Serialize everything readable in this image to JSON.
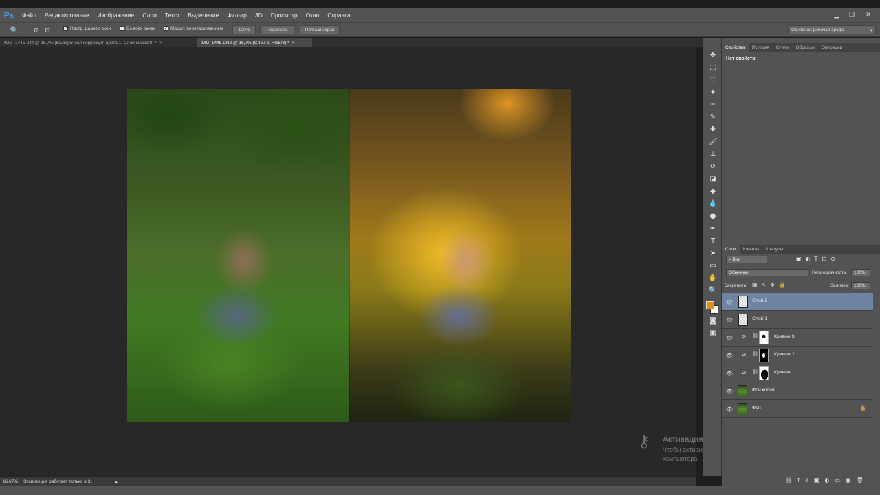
{
  "app": {
    "logo": "Ps"
  },
  "menu": [
    "Файл",
    "Редактирование",
    "Изображение",
    "Слои",
    "Текст",
    "Выделение",
    "Фильтр",
    "3D",
    "Просмотр",
    "Окно",
    "Справка"
  ],
  "options": {
    "resize_windows": "Настр. размер окон",
    "all_windows": "Во всех окнах",
    "scrubby_zoom": "Масшт. перетаскиванием",
    "zoom_100": "100%",
    "fit_button": "Подогнать",
    "fill_screen": "Полный экран",
    "workspace": "Основная рабочая среда"
  },
  "tabs": [
    {
      "label": "IMG_1445-2.tif @ 16,7% (Выборочная коррекция цвета 1, Слой-маска/8) *"
    },
    {
      "label": "IMG_1445.CR2 @ 16,7% (Слой 2, RGB/8) *"
    }
  ],
  "status": {
    "zoom": "16,67%",
    "message": "Экспозиция работает только в 3..."
  },
  "properties_panel": {
    "tabs": [
      "Свойства",
      "История",
      "Стили",
      "Образцы",
      "Операции"
    ],
    "title": "Нет свойств"
  },
  "layers_panel": {
    "tabs": [
      "Слои",
      "Каналы",
      "Контуры"
    ],
    "filter_label": "Вид",
    "blend_mode": "Обычные",
    "opacity_label": "Непрозрачность:",
    "opacity_value": "100%",
    "lock_label": "Закрепить:",
    "fill_label": "Заливка:",
    "fill_value": "100%",
    "layers": [
      {
        "name": "Слой 2",
        "type": "pixel",
        "selected": true
      },
      {
        "name": "Слой 1",
        "type": "pixel",
        "selected": false
      },
      {
        "name": "Кривые 3",
        "type": "curves",
        "selected": false
      },
      {
        "name": "Кривые 2",
        "type": "curves",
        "selected": false
      },
      {
        "name": "Кривые 1",
        "type": "curves",
        "selected": false
      },
      {
        "name": "Фон копия",
        "type": "photo",
        "selected": false
      },
      {
        "name": "Фон",
        "type": "photo",
        "selected": false,
        "locked": true
      }
    ]
  },
  "watermark": {
    "title": "Активация Windows",
    "text": "Чтобы активировать Windows, перейдите к параметрам компьютера."
  },
  "colors": {
    "foreground": "#e5900a",
    "background": "#ffffff",
    "selected_layer": "#6d84a3"
  }
}
